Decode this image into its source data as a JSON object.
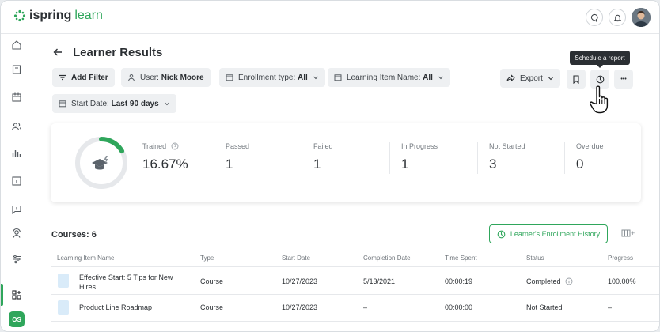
{
  "app": {
    "brand": "ispring",
    "brand_suffix": "learn",
    "user_initials": "OS"
  },
  "page": {
    "title": "Learner Results"
  },
  "filters": {
    "add_filter": "Add Filter",
    "user_prefix": "User:",
    "user_value": "Nick Moore",
    "enrollment_prefix": "Enrollment type:",
    "enrollment_value": "All",
    "item_prefix": "Learning Item Name:",
    "item_value": "All",
    "date_prefix": "Start Date:",
    "date_value": "Last 90 days"
  },
  "toolbar": {
    "export": "Export",
    "tooltip": "Schedule a report",
    "more": "•••"
  },
  "stats": {
    "trained_label": "Trained",
    "trained_value": "16.67%",
    "trained_fraction": 0.1667,
    "passed_label": "Passed",
    "passed_value": "1",
    "failed_label": "Failed",
    "failed_value": "1",
    "inprogress_label": "In Progress",
    "inprogress_value": "1",
    "notstarted_label": "Not Started",
    "notstarted_value": "3",
    "overdue_label": "Overdue",
    "overdue_value": "0"
  },
  "courses": {
    "label": "Courses: 6",
    "history_button": "Learner's Enrollment History",
    "columns_toggle": "+",
    "headers": [
      "Learning Item Name",
      "Type",
      "Start Date",
      "Completion Date",
      "Time Spent",
      "Status",
      "Progress"
    ],
    "rows": [
      {
        "name_line1": "Effective Start: 5 Tips for New",
        "name_line2": "Hires",
        "type": "Course",
        "start": "10/27/2023",
        "completion": "5/13/2021",
        "time": "00:00:19",
        "status": "Completed",
        "progress": "100.00%"
      },
      {
        "name_line1": "Product Line Roadmap",
        "name_line2": "",
        "type": "Course",
        "start": "10/27/2023",
        "completion": "–",
        "time": "00:00:00",
        "status": "Not Started",
        "progress": "–"
      }
    ]
  },
  "colors": {
    "accent": "#2fa65b",
    "text": "#2b2f33",
    "chip_bg": "#eef0f2"
  }
}
